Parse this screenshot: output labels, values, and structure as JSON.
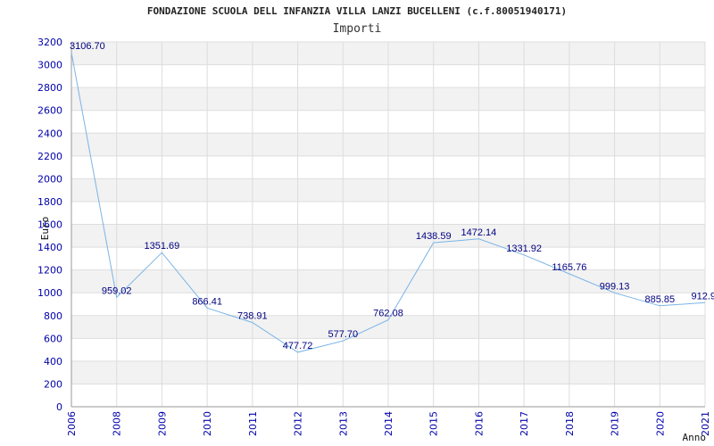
{
  "chart_data": {
    "type": "line",
    "title": "FONDAZIONE SCUOLA DELL INFANZIA VILLA LANZI BUCELLENI (c.f.80051940171)",
    "subtitle": "Importi",
    "xlabel": "Anno",
    "ylabel": "Euro",
    "ylim": [
      0,
      3200
    ],
    "yticks": [
      0,
      200,
      400,
      600,
      800,
      1000,
      1200,
      1400,
      1600,
      1800,
      2000,
      2200,
      2400,
      2600,
      2800,
      3000,
      3200
    ],
    "grid": true,
    "x": [
      "2006",
      "2008",
      "2009",
      "2010",
      "2011",
      "2012",
      "2013",
      "2014",
      "2015",
      "2016",
      "2017",
      "2018",
      "2019",
      "2020",
      "2021"
    ],
    "values": [
      3106.7,
      959.02,
      1351.69,
      866.41,
      738.91,
      477.72,
      577.7,
      762.08,
      1438.59,
      1472.14,
      1331.92,
      1165.76,
      999.13,
      885.85,
      912.9
    ],
    "value_labels": [
      "3106.70",
      "959.02",
      "1351.69",
      "866.41",
      "738.91",
      "477.72",
      "577.70",
      "762.08",
      "1438.59",
      "1472.14",
      "1331.92",
      "1165.76",
      "999.13",
      "885.85",
      "912.9"
    ],
    "colors": {
      "line": "#7ab4e6",
      "band": "#f2f2f2",
      "grid": "#dddddd",
      "tick_text": "#0000aa",
      "label_text": "#000080"
    }
  }
}
